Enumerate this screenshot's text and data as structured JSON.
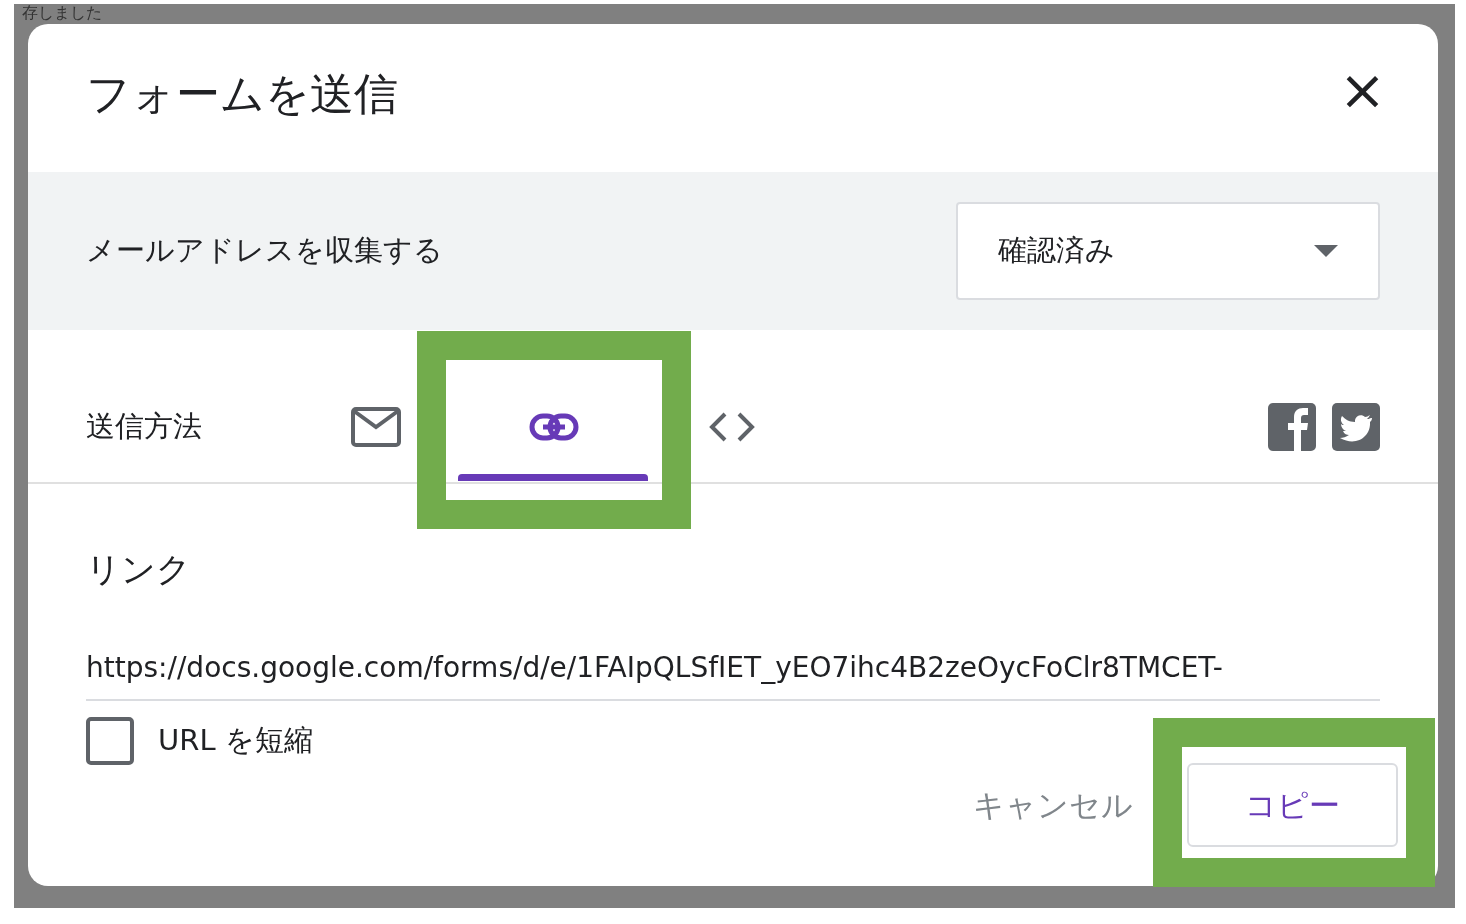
{
  "background": {
    "fragment": "存しました"
  },
  "dialog": {
    "title": "フォームを送信",
    "close": "×"
  },
  "email_collection": {
    "label": "メールアドレスを収集する",
    "value": "確認済み"
  },
  "send_methods": {
    "label": "送信方法",
    "tabs": [
      {
        "kind": "email",
        "selected": false,
        "highlighted": false
      },
      {
        "kind": "link",
        "selected": true,
        "highlighted": true
      },
      {
        "kind": "embed",
        "selected": false,
        "highlighted": false
      }
    ],
    "share": [
      {
        "kind": "facebook"
      },
      {
        "kind": "twitter"
      }
    ]
  },
  "link": {
    "heading": "リンク",
    "url": "https://docs.google.com/forms/d/e/1FAIpQLSfIET_yEO7ihc4B2zeOycFoClr8TMCET-",
    "shorten": {
      "label": "URL を短縮",
      "checked": false
    }
  },
  "buttons": [
    {
      "label": "キャンセル",
      "kind": "text",
      "highlighted": false
    },
    {
      "label": "コピー",
      "kind": "outlined",
      "highlighted": true
    }
  ]
}
